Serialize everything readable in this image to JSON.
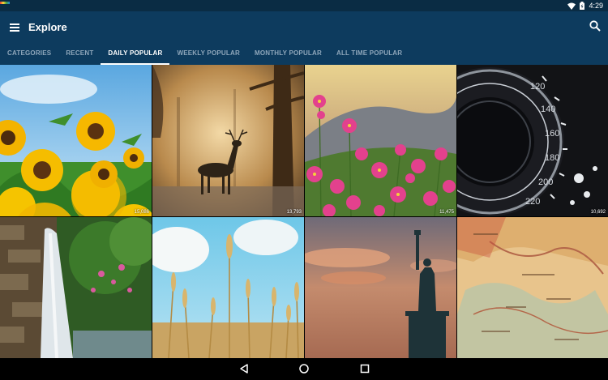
{
  "status": {
    "time": "4:29",
    "icons": [
      "wifi-icon",
      "battery-icon"
    ]
  },
  "header": {
    "title": "Explore",
    "menu_icon": "menu-icon",
    "search_icon": "search-icon"
  },
  "tabs": [
    {
      "label": "CATEGORIES",
      "active": false
    },
    {
      "label": "RECENT",
      "active": false
    },
    {
      "label": "DAILY POPULAR",
      "active": true
    },
    {
      "label": "WEEKLY POPULAR",
      "active": false
    },
    {
      "label": "MONTHLY POPULAR",
      "active": false
    },
    {
      "label": "ALL TIME POPULAR",
      "active": false
    }
  ],
  "wallpapers": [
    {
      "subject": "sunflowers",
      "count": "15,086"
    },
    {
      "subject": "deer",
      "count": "13,793"
    },
    {
      "subject": "pink-flowers",
      "count": "11,475"
    },
    {
      "subject": "speedometer",
      "count": "10,692"
    },
    {
      "subject": "waterfall",
      "count": ""
    },
    {
      "subject": "wheat",
      "count": ""
    },
    {
      "subject": "statue-of-liberty",
      "count": ""
    },
    {
      "subject": "vintage-map",
      "count": ""
    }
  ],
  "nav": {
    "icons": [
      "back-icon",
      "home-icon",
      "recents-icon"
    ]
  },
  "colors": {
    "app_bar": "#0d3b5e",
    "status_bar": "#0a2c44",
    "tab_inactive": "#8fa7bb"
  }
}
